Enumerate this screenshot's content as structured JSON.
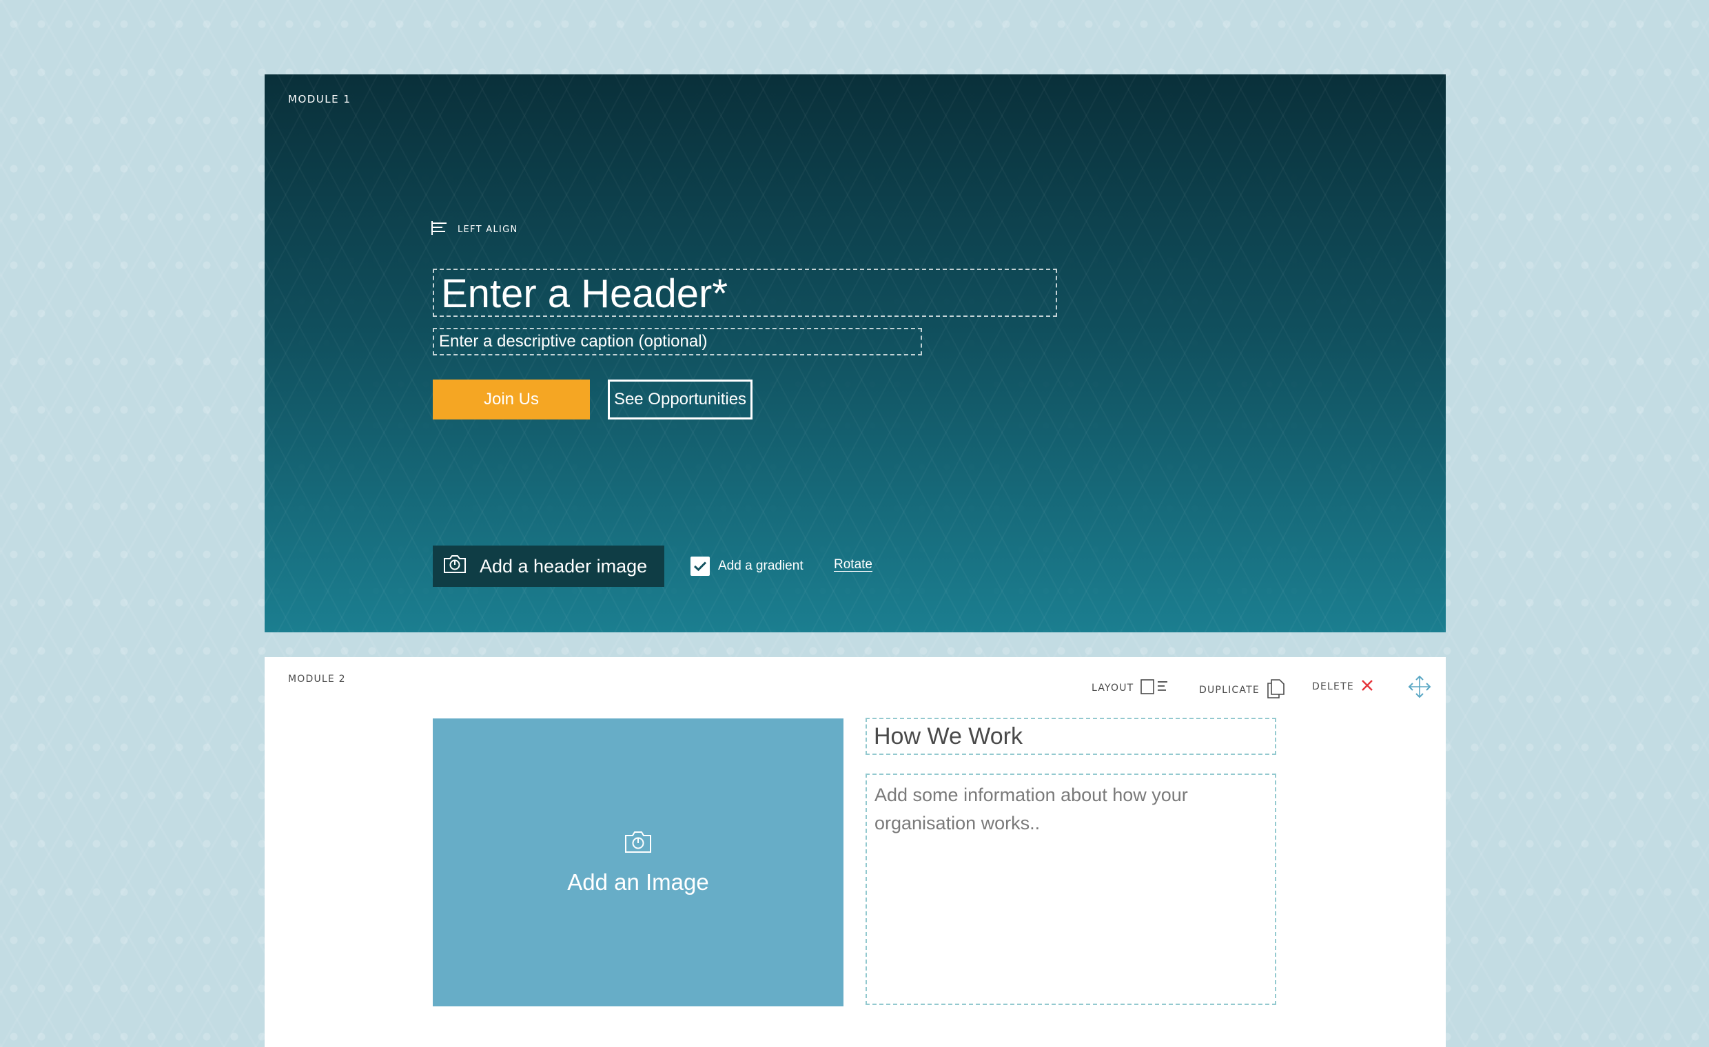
{
  "module1": {
    "label": "MODULE 1",
    "align_label": "LEFT ALIGN",
    "header_placeholder": "Enter a Header*",
    "caption_placeholder": "Enter a  descriptive caption (optional)",
    "primary_button": "Join Us",
    "secondary_button": "See Opportunities",
    "header_image_button": "Add a header image",
    "gradient_label": "Add a gradient",
    "gradient_checked": true,
    "rotate_link": "Rotate",
    "icons": {
      "align": "left-align-icon",
      "camera": "camera-icon",
      "check": "checkmark-icon"
    },
    "colors": {
      "primary_button": "#f5a623",
      "image_button_bg": "#0f3d45"
    }
  },
  "module2": {
    "label": "MODULE 2",
    "toolbar": {
      "layout_label": "LAYOUT",
      "duplicate_label": "DUPLICATE",
      "delete_label": "DELETE"
    },
    "image_placeholder": "Add an Image",
    "title_value": "How We Work",
    "body_placeholder": "Add some information about how your organisation works..",
    "icons": {
      "layout": "layout-icon",
      "duplicate": "duplicate-icon",
      "delete": "close-icon",
      "move": "move-icon",
      "camera": "camera-icon"
    },
    "colors": {
      "image_placeholder_bg": "#67adc7",
      "delete_icon": "#e5343a",
      "move_icon": "#5aa7c4"
    }
  }
}
